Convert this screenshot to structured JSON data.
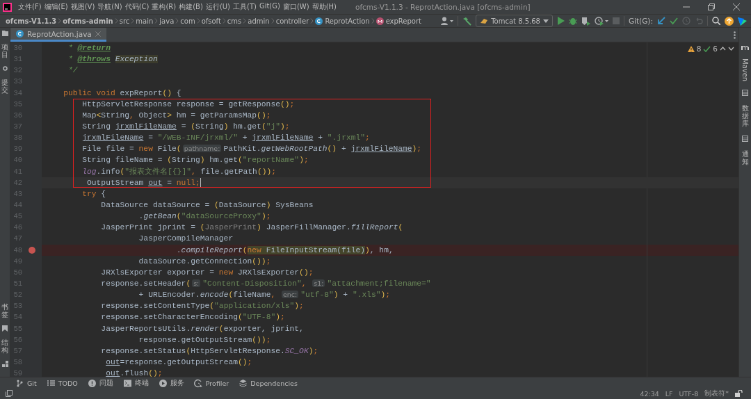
{
  "window": {
    "title": "ofcms-V1.1.3 - ReprotAction.java [ofcms-admin]"
  },
  "menu": [
    "文件(F)",
    "编辑(E)",
    "视图(V)",
    "导航(N)",
    "代码(C)",
    "重构(R)",
    "构建(B)",
    "运行(U)",
    "工具(T)",
    "Git(G)",
    "窗口(W)",
    "帮助(H)"
  ],
  "breadcrumb": [
    {
      "label": "ofcms-V1.1.3",
      "kind": "module"
    },
    {
      "label": "ofcms-admin",
      "kind": "module"
    },
    {
      "label": "src",
      "kind": "folder"
    },
    {
      "label": "main",
      "kind": "folder"
    },
    {
      "label": "java",
      "kind": "folder"
    },
    {
      "label": "com",
      "kind": "folder"
    },
    {
      "label": "ofsoft",
      "kind": "folder"
    },
    {
      "label": "cms",
      "kind": "folder"
    },
    {
      "label": "admin",
      "kind": "folder"
    },
    {
      "label": "controller",
      "kind": "folder"
    },
    {
      "label": "ReprotAction",
      "kind": "class"
    },
    {
      "label": "expReport",
      "kind": "method"
    }
  ],
  "toolbar": {
    "run_config": "Tomcat 8.5.68",
    "git_label": "Git(G):"
  },
  "left_strip": {
    "top": [
      "项目",
      "提交"
    ],
    "bottom": [
      "书签",
      "结构"
    ]
  },
  "right_strip": [
    {
      "label": "Maven",
      "kind": "rotated"
    },
    {
      "label": "数据库",
      "kind": "stacked"
    },
    {
      "label": "通知",
      "kind": "stacked"
    }
  ],
  "tabs": [
    {
      "label": "ReprotAction.java",
      "selected": true
    }
  ],
  "inspections": {
    "warnings": "8",
    "weak_warnings": "6"
  },
  "lines": [
    {
      "number": "30",
      "current": false,
      "breakpoint": false,
      "boxed": false,
      "tokens": [
        {
          "kind": "doc",
          "text": "     * "
        },
        {
          "kind": "doctag",
          "text": "@return"
        }
      ]
    },
    {
      "number": "31",
      "current": false,
      "breakpoint": false,
      "boxed": false,
      "tokens": [
        {
          "kind": "doc",
          "text": "     * "
        },
        {
          "kind": "doctag",
          "text": "@throws"
        },
        {
          "kind": "docref",
          "text": " Exception"
        }
      ]
    },
    {
      "number": "32",
      "current": false,
      "breakpoint": false,
      "boxed": false,
      "tokens": [
        {
          "kind": "doc",
          "text": "     */"
        }
      ]
    },
    {
      "number": "33",
      "current": false,
      "breakpoint": false,
      "boxed": false
    },
    {
      "number": "34",
      "current": false,
      "breakpoint": false,
      "boxed": false,
      "tokens": [
        {
          "kind": "keyword",
          "text": "    public void "
        },
        {
          "kind": "plain",
          "text": "expReport"
        },
        {
          "kind": "bracket",
          "text": "()"
        },
        {
          "kind": "plain",
          "text": " {"
        }
      ]
    },
    {
      "number": "35",
      "current": false,
      "breakpoint": false,
      "boxed": true,
      "tokens": [
        {
          "kind": "plain",
          "text": "        HttpServletResponse response = getResponse"
        },
        {
          "kind": "bracket",
          "text": "()"
        },
        {
          "kind": "keyword",
          "text": ";"
        }
      ]
    },
    {
      "number": "36",
      "current": false,
      "breakpoint": false,
      "boxed": true,
      "tokens": [
        {
          "kind": "plain",
          "text": "        Map"
        },
        {
          "kind": "bracket",
          "text": "<"
        },
        {
          "kind": "plain",
          "text": "String"
        },
        {
          "kind": "keyword",
          "text": ", "
        },
        {
          "kind": "plain",
          "text": "Object"
        },
        {
          "kind": "bracket",
          "text": ">"
        },
        {
          "kind": "plain",
          "text": " hm = getParamsMap"
        },
        {
          "kind": "bracket",
          "text": "()"
        },
        {
          "kind": "keyword",
          "text": ";"
        }
      ]
    },
    {
      "number": "37",
      "current": false,
      "breakpoint": false,
      "boxed": true,
      "tokens": [
        {
          "kind": "plain",
          "text": "        String "
        },
        {
          "kind": "underline",
          "text": "jrxmlFileName"
        },
        {
          "kind": "plain",
          "text": " = "
        },
        {
          "kind": "bracket",
          "text": "("
        },
        {
          "kind": "plain",
          "text": "String"
        },
        {
          "kind": "bracket",
          "text": ")"
        },
        {
          "kind": "plain",
          "text": " hm.get"
        },
        {
          "kind": "bracket",
          "text": "("
        },
        {
          "kind": "string",
          "text": "\"j\""
        },
        {
          "kind": "bracket",
          "text": ")"
        },
        {
          "kind": "keyword",
          "text": ";"
        }
      ]
    },
    {
      "number": "38",
      "current": false,
      "breakpoint": false,
      "boxed": true,
      "tokens": [
        {
          "kind": "underline",
          "text": "        jrxmlFileName"
        },
        {
          "kind": "plain",
          "text": " = "
        },
        {
          "kind": "string",
          "text": "\"/WEB-INF/jrxml/\""
        },
        {
          "kind": "plain",
          "text": " + "
        },
        {
          "kind": "underline",
          "text": "jrxmlFileName"
        },
        {
          "kind": "plain",
          "text": " + "
        },
        {
          "kind": "string",
          "text": "\".jrxml\""
        },
        {
          "kind": "keyword",
          "text": ";"
        }
      ]
    },
    {
      "number": "39",
      "current": false,
      "breakpoint": false,
      "boxed": true,
      "tokens": [
        {
          "kind": "plain",
          "text": "        File file = "
        },
        {
          "kind": "keyword",
          "text": "new "
        },
        {
          "kind": "plain",
          "text": "File"
        },
        {
          "kind": "bracket",
          "text": "("
        },
        {
          "kind": "hint",
          "text": "pathname:"
        },
        {
          "kind": "plain",
          "text": "PathKit."
        },
        {
          "kind": "italic",
          "text": "getWebRootPath"
        },
        {
          "kind": "bracket",
          "text": "()"
        },
        {
          "kind": "plain",
          "text": " + "
        },
        {
          "kind": "underline",
          "text": "jrxmlFileName"
        },
        {
          "kind": "bracket",
          "text": ")"
        },
        {
          "kind": "keyword",
          "text": ";"
        }
      ]
    },
    {
      "number": "40",
      "current": false,
      "breakpoint": false,
      "boxed": true,
      "tokens": [
        {
          "kind": "plain",
          "text": "        String fileName = "
        },
        {
          "kind": "bracket",
          "text": "("
        },
        {
          "kind": "plain",
          "text": "String"
        },
        {
          "kind": "bracket",
          "text": ")"
        },
        {
          "kind": "plain",
          "text": " hm.get"
        },
        {
          "kind": "bracket",
          "text": "("
        },
        {
          "kind": "string",
          "text": "\"reportName\""
        },
        {
          "kind": "bracket",
          "text": ")"
        },
        {
          "kind": "keyword",
          "text": ";"
        }
      ]
    },
    {
      "number": "41",
      "current": false,
      "breakpoint": false,
      "boxed": true,
      "tokens": [
        {
          "kind": "field",
          "text": "        log"
        },
        {
          "kind": "plain",
          "text": ".info"
        },
        {
          "kind": "bracket",
          "text": "("
        },
        {
          "kind": "string",
          "text": "\"报表文件名[{}]\""
        },
        {
          "kind": "keyword",
          "text": ", "
        },
        {
          "kind": "plain",
          "text": "file.getPath"
        },
        {
          "kind": "bracket",
          "text": "())"
        },
        {
          "kind": "keyword",
          "text": ";"
        }
      ]
    },
    {
      "number": "42",
      "current": true,
      "breakpoint": false,
      "boxed": true,
      "tokens": [
        {
          "kind": "plain",
          "text": "         OutputStream "
        },
        {
          "kind": "underline",
          "text": "out"
        },
        {
          "kind": "plain",
          "text": " = "
        },
        {
          "kind": "keyword",
          "text": "null;"
        }
      ]
    },
    {
      "number": "43",
      "current": false,
      "breakpoint": false,
      "boxed": false,
      "tokens": [
        {
          "kind": "keyword",
          "text": "        try"
        },
        {
          "kind": "plain",
          "text": " {"
        }
      ]
    },
    {
      "number": "44",
      "current": false,
      "breakpoint": false,
      "boxed": false,
      "tokens": [
        {
          "kind": "plain",
          "text": "            DataSource dataSource = "
        },
        {
          "kind": "bracket",
          "text": "("
        },
        {
          "kind": "plain",
          "text": "DataSource"
        },
        {
          "kind": "bracket",
          "text": ")"
        },
        {
          "kind": "plain",
          "text": " SysBeans"
        }
      ]
    },
    {
      "number": "45",
      "current": false,
      "breakpoint": false,
      "boxed": false,
      "tokens": [
        {
          "kind": "plain",
          "text": "                    ."
        },
        {
          "kind": "italic",
          "text": "getBean"
        },
        {
          "kind": "bracket",
          "text": "("
        },
        {
          "kind": "string",
          "text": "\"dataSourceProxy\""
        },
        {
          "kind": "bracket",
          "text": ")"
        },
        {
          "kind": "keyword",
          "text": ";"
        }
      ]
    },
    {
      "number": "46",
      "current": false,
      "breakpoint": false,
      "boxed": false,
      "tokens": [
        {
          "kind": "plain",
          "text": "            JasperPrint jprint = "
        },
        {
          "kind": "bracket",
          "text": "("
        },
        {
          "kind": "muted",
          "text": "JasperPrint"
        },
        {
          "kind": "bracket",
          "text": ")"
        },
        {
          "kind": "plain",
          "text": " JasperFillManager."
        },
        {
          "kind": "italic",
          "text": "fillReport"
        },
        {
          "kind": "bracket",
          "text": "("
        }
      ]
    },
    {
      "number": "47",
      "current": false,
      "breakpoint": false,
      "boxed": false,
      "tokens": [
        {
          "kind": "plain",
          "text": "                    JasperCompileManager"
        }
      ]
    },
    {
      "number": "48",
      "current": false,
      "breakpoint": true,
      "boxed": false,
      "tokens": [
        {
          "kind": "plain",
          "text": "                            ."
        },
        {
          "kind": "italic",
          "text": "compileReport"
        },
        {
          "kind": "bracket",
          "text": "("
        },
        {
          "kind": "matched_keyword",
          "text": "new "
        },
        {
          "kind": "matched",
          "text": "FileInputStream(file)"
        },
        {
          "kind": "bracket",
          "text": ")"
        },
        {
          "kind": "plain",
          "text": ", hm,"
        }
      ]
    },
    {
      "number": "49",
      "current": false,
      "breakpoint": false,
      "boxed": false,
      "tokens": [
        {
          "kind": "plain",
          "text": "                    dataSource.getConnection"
        },
        {
          "kind": "bracket",
          "text": "())"
        },
        {
          "kind": "keyword",
          "text": ";"
        }
      ]
    },
    {
      "number": "50",
      "current": false,
      "breakpoint": false,
      "boxed": false,
      "tokens": [
        {
          "kind": "plain",
          "text": "            JRXlsExporter exporter = "
        },
        {
          "kind": "keyword",
          "text": "new "
        },
        {
          "kind": "plain",
          "text": "JRXlsExporter"
        },
        {
          "kind": "bracket",
          "text": "()"
        },
        {
          "kind": "keyword",
          "text": ";"
        }
      ]
    },
    {
      "number": "51",
      "current": false,
      "breakpoint": false,
      "boxed": false,
      "tokens": [
        {
          "kind": "plain",
          "text": "            response.setHeader"
        },
        {
          "kind": "bracket",
          "text": "("
        },
        {
          "kind": "hint",
          "text": "s:"
        },
        {
          "kind": "string",
          "text": "\"Content-Disposition\""
        },
        {
          "kind": "keyword",
          "text": ", "
        },
        {
          "kind": "hint",
          "text": "s1:"
        },
        {
          "kind": "string",
          "text": "\"attachment;filename=\""
        }
      ]
    },
    {
      "number": "52",
      "current": false,
      "breakpoint": false,
      "boxed": false,
      "tokens": [
        {
          "kind": "plain",
          "text": "                    + URLEncoder."
        },
        {
          "kind": "italic",
          "text": "encode"
        },
        {
          "kind": "bracket",
          "text": "("
        },
        {
          "kind": "plain",
          "text": "fileName"
        },
        {
          "kind": "keyword",
          "text": ", "
        },
        {
          "kind": "hint",
          "text": "enc:"
        },
        {
          "kind": "string",
          "text": "\"utf-8\""
        },
        {
          "kind": "bracket",
          "text": ")"
        },
        {
          "kind": "plain",
          "text": " + "
        },
        {
          "kind": "string",
          "text": "\".xls\""
        },
        {
          "kind": "bracket",
          "text": ")"
        },
        {
          "kind": "keyword",
          "text": ";"
        }
      ]
    },
    {
      "number": "53",
      "current": false,
      "breakpoint": false,
      "boxed": false,
      "tokens": [
        {
          "kind": "plain",
          "text": "            response.setContentType"
        },
        {
          "kind": "bracket",
          "text": "("
        },
        {
          "kind": "string",
          "text": "\"application/xls\""
        },
        {
          "kind": "bracket",
          "text": ")"
        },
        {
          "kind": "keyword",
          "text": ";"
        }
      ]
    },
    {
      "number": "54",
      "current": false,
      "breakpoint": false,
      "boxed": false,
      "tokens": [
        {
          "kind": "plain",
          "text": "            response.setCharacterEncoding"
        },
        {
          "kind": "bracket",
          "text": "("
        },
        {
          "kind": "string",
          "text": "\"UTF-8\""
        },
        {
          "kind": "bracket",
          "text": ")"
        },
        {
          "kind": "keyword",
          "text": ";"
        }
      ]
    },
    {
      "number": "55",
      "current": false,
      "breakpoint": false,
      "boxed": false,
      "tokens": [
        {
          "kind": "plain",
          "text": "            JasperReportsUtils."
        },
        {
          "kind": "italic",
          "text": "render"
        },
        {
          "kind": "bracket",
          "text": "("
        },
        {
          "kind": "plain",
          "text": "exporter, jprint,"
        }
      ]
    },
    {
      "number": "56",
      "current": false,
      "breakpoint": false,
      "boxed": false,
      "tokens": [
        {
          "kind": "plain",
          "text": "                    response.getOutputStream"
        },
        {
          "kind": "bracket",
          "text": "())"
        },
        {
          "kind": "keyword",
          "text": ";"
        }
      ]
    },
    {
      "number": "57",
      "current": false,
      "breakpoint": false,
      "boxed": false,
      "tokens": [
        {
          "kind": "plain",
          "text": "            response.setStatus"
        },
        {
          "kind": "bracket",
          "text": "("
        },
        {
          "kind": "plain",
          "text": "HttpServletResponse."
        },
        {
          "kind": "field",
          "text": "SC_OK"
        },
        {
          "kind": "bracket",
          "text": ")"
        },
        {
          "kind": "keyword",
          "text": ";"
        }
      ]
    },
    {
      "number": "58",
      "current": false,
      "breakpoint": false,
      "boxed": false,
      "tokens": [
        {
          "kind": "underline",
          "text": "             out"
        },
        {
          "kind": "plain",
          "text": "=response.getOutputStream"
        },
        {
          "kind": "bracket",
          "text": "()"
        },
        {
          "kind": "keyword",
          "text": ";"
        }
      ]
    },
    {
      "number": "59",
      "current": false,
      "breakpoint": false,
      "boxed": false,
      "tokens": [
        {
          "kind": "underline",
          "text": "             out"
        },
        {
          "kind": "plain",
          "text": ".flush"
        },
        {
          "kind": "bracket",
          "text": "()"
        },
        {
          "kind": "keyword",
          "text": ";"
        }
      ]
    }
  ],
  "tool_windows": [
    {
      "label": "Git",
      "kind": "git"
    },
    {
      "label": "TODO",
      "kind": "todo"
    },
    {
      "label": "问题",
      "kind": "problems"
    },
    {
      "label": "终端",
      "kind": "terminal"
    },
    {
      "label": "服务",
      "kind": "services"
    },
    {
      "label": "Profiler",
      "kind": "profiler"
    },
    {
      "label": "Dependencies",
      "kind": "dependencies"
    }
  ],
  "status": [
    "42:34",
    "LF",
    "UTF-8",
    "制表符*"
  ]
}
